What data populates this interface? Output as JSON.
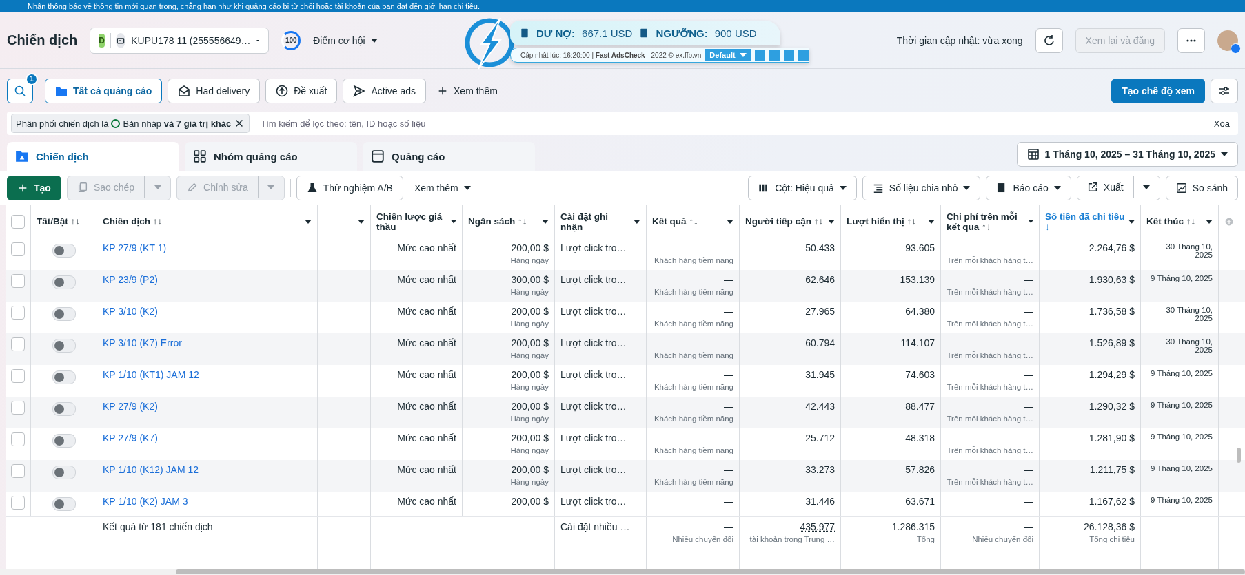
{
  "banner": {
    "text": "Nhận thông báo về thông tin mới quan trọng, chẳng hạn như khi quảng cáo bị từ chối hoặc tài khoản của bạn đạt đến giới hạn chi tiêu."
  },
  "header": {
    "title": "Chiến dịch",
    "account": {
      "badge": "D",
      "name": "KUPU178 11 (255556649…"
    },
    "score": {
      "value": "100",
      "label": "Điểm cơ hội"
    },
    "updated": "Thời gian cập nhật: vừa xong",
    "review_button": {
      "label": "Xem lại và đăng",
      "disabled": true
    }
  },
  "adscheck": {
    "debt_label": "DƯ NỢ:",
    "debt": "667.1 USD",
    "threshold_label": "NGƯỠNG:",
    "threshold": "900 USD",
    "footer": "Cập nhật lúc: 16:20:00 | **Fast AdsCheck** - 2022 © ex.ffb.vn",
    "preset": "Default"
  },
  "search_badge": "1",
  "views": [
    {
      "label": "Tất cả quảng cáo",
      "kind": "folder",
      "selected": true
    },
    {
      "label": "Had delivery",
      "kind": "envelope",
      "selected": false
    },
    {
      "label": "Đề xuất",
      "kind": "upload",
      "selected": false
    },
    {
      "label": "Active ads",
      "kind": "send",
      "selected": false
    }
  ],
  "more_views": "Xem thêm",
  "create_view": "Tạo chế độ xem",
  "filter": {
    "field": "Phân phối chiến dịch là",
    "value": "Bản nháp **và 7 giá trị khác**",
    "placeholder": "Tìm kiếm để lọc theo: tên, ID hoặc số liệu",
    "clear": "Xóa"
  },
  "levels": [
    {
      "label": "Chiến dịch",
      "kind": "campaign",
      "selected": true
    },
    {
      "label": "Nhóm quảng cáo",
      "kind": "adset",
      "selected": false
    },
    {
      "label": "Quảng cáo",
      "kind": "ad",
      "selected": false
    }
  ],
  "date_range": "1 Tháng 10, 2025 – 31 Tháng 10, 2025",
  "actions": {
    "create": "Tạo",
    "copy": {
      "label": "Sao chép",
      "disabled": true
    },
    "edit": {
      "label": "Chỉnh sửa",
      "disabled": true
    },
    "ab_test": "Thử nghiệm A/B",
    "more": "Xem thêm",
    "columns": "Cột: Hiệu quả",
    "breakdown": "Số liệu chia nhỏ",
    "reports": "Báo cáo",
    "export": "Xuất",
    "compare": "So sánh"
  },
  "table": {
    "all_checked": false,
    "columns": [
      {
        "label": "Tất/Bật ↑↓"
      },
      {
        "label": "Chiến dịch ↑↓"
      },
      {},
      {
        "label": "Chiến lược giá thầu"
      },
      {
        "label": "Ngân sách ↑↓"
      },
      {
        "label": "Cài đặt ghi nhận"
      },
      {
        "label": "Kết quả ↑↓"
      },
      {
        "label": "Người tiếp cận ↑↓"
      },
      {
        "label": "Lượt hiển thị ↑↓"
      },
      {
        "label": "Chi phí trên mỗi kết quả ↑↓"
      },
      {
        "label": "Số tiền đã chi tiêu ↓",
        "sorted": true
      },
      {
        "label": "Kết thúc ↑↓"
      }
    ],
    "rows": [
      {
        "checked": false,
        "on": false,
        "name": "KP 27/9 (KT 1)",
        "strategy": "Mức cao nhất",
        "budget": "200,00 $",
        "budget_period": "Hàng ngày",
        "attribution": "Lượt click tro…",
        "result": "—",
        "result_type": "Khách hàng tiềm năng",
        "reach": "50.433",
        "impressions": "93.605",
        "cost": "—",
        "cost_type": "Trên mỗi khách hàng t…",
        "spent": "2.264,76 $",
        "end": "30 Tháng 10, 2025"
      },
      {
        "checked": false,
        "on": false,
        "name": "KP 23/9 (P2)",
        "strategy": "Mức cao nhất",
        "budget": "300,00 $",
        "budget_period": "Hàng ngày",
        "attribution": "Lượt click tro…",
        "result": "—",
        "result_type": "Khách hàng tiềm năng",
        "reach": "62.646",
        "impressions": "153.139",
        "cost": "—",
        "cost_type": "Trên mỗi khách hàng t…",
        "spent": "1.930,63 $",
        "end": "9 Tháng 10, 2025"
      },
      {
        "checked": false,
        "on": false,
        "name": "KP 3/10 (K2)",
        "strategy": "Mức cao nhất",
        "budget": "200,00 $",
        "budget_period": "Hàng ngày",
        "attribution": "Lượt click tro…",
        "result": "—",
        "result_type": "Khách hàng tiềm năng",
        "reach": "27.965",
        "impressions": "64.380",
        "cost": "—",
        "cost_type": "Trên mỗi khách hàng t…",
        "spent": "1.736,58 $",
        "end": "30 Tháng 10, 2025"
      },
      {
        "checked": false,
        "on": false,
        "name": "KP 3/10 (K7) Error",
        "strategy": "Mức cao nhất",
        "budget": "200,00 $",
        "budget_period": "Hàng ngày",
        "attribution": "Lượt click tro…",
        "result": "—",
        "result_type": "Khách hàng tiềm năng",
        "reach": "60.794",
        "impressions": "114.107",
        "cost": "—",
        "cost_type": "Trên mỗi khách hàng t…",
        "spent": "1.526,89 $",
        "end": "30 Tháng 10, 2025"
      },
      {
        "checked": false,
        "on": false,
        "name": "KP 1/10 (KT1) JAM 12",
        "strategy": "Mức cao nhất",
        "budget": "200,00 $",
        "budget_period": "Hàng ngày",
        "attribution": "Lượt click tro…",
        "result": "—",
        "result_type": "Khách hàng tiềm năng",
        "reach": "31.945",
        "impressions": "74.603",
        "cost": "—",
        "cost_type": "Trên mỗi khách hàng t…",
        "spent": "1.294,29 $",
        "end": "9 Tháng 10, 2025"
      },
      {
        "checked": false,
        "on": false,
        "name": "KP 27/9 (K2)",
        "strategy": "Mức cao nhất",
        "budget": "200,00 $",
        "budget_period": "Hàng ngày",
        "attribution": "Lượt click tro…",
        "result": "—",
        "result_type": "Khách hàng tiềm năng",
        "reach": "42.443",
        "impressions": "88.477",
        "cost": "—",
        "cost_type": "Trên mỗi khách hàng t…",
        "spent": "1.290,32 $",
        "end": "9 Tháng 10, 2025"
      },
      {
        "checked": false,
        "on": false,
        "name": "KP 27/9 (K7)",
        "strategy": "Mức cao nhất",
        "budget": "200,00 $",
        "budget_period": "Hàng ngày",
        "attribution": "Lượt click tro…",
        "result": "—",
        "result_type": "Khách hàng tiềm năng",
        "reach": "25.712",
        "impressions": "48.318",
        "cost": "—",
        "cost_type": "Trên mỗi khách hàng t…",
        "spent": "1.281,90 $",
        "end": "9 Tháng 10, 2025"
      },
      {
        "checked": false,
        "on": false,
        "name": "KP 1/10 (K12) JAM 12",
        "strategy": "Mức cao nhất",
        "budget": "200,00 $",
        "budget_period": "Hàng ngày",
        "attribution": "Lượt click tro…",
        "result": "—",
        "result_type": "Khách hàng tiềm năng",
        "reach": "33.273",
        "impressions": "57.826",
        "cost": "—",
        "cost_type": "Trên mỗi khách hàng t…",
        "spent": "1.211,75 $",
        "end": "9 Tháng 10, 2025"
      },
      {
        "checked": false,
        "on": false,
        "name": "KP 1/10 (K2) JAM 3",
        "strategy": "Mức cao nhất",
        "budget": "200,00 $",
        "attribution": "Lượt click tro…",
        "result": "—",
        "reach": "31.446",
        "impressions": "63.671",
        "cost": "—",
        "spent": "1.167,62 $",
        "end": "9 Tháng 10, 2025"
      }
    ],
    "footer": {
      "summary": "Kết quả từ 181 chiến dịch",
      "attribution": "Cài đặt nhiều …",
      "result": "—",
      "result_type": "Nhiều chuyển đổi",
      "reach": "435.977",
      "reach_type": "tài khoản trong Trung …",
      "impressions": "1.286.315",
      "impressions_type": "Tổng",
      "cost": "—",
      "cost_type": "Nhiều chuyển đổi",
      "spent": "26.128,36 $",
      "spent_type": "Tổng chi tiêu"
    }
  }
}
